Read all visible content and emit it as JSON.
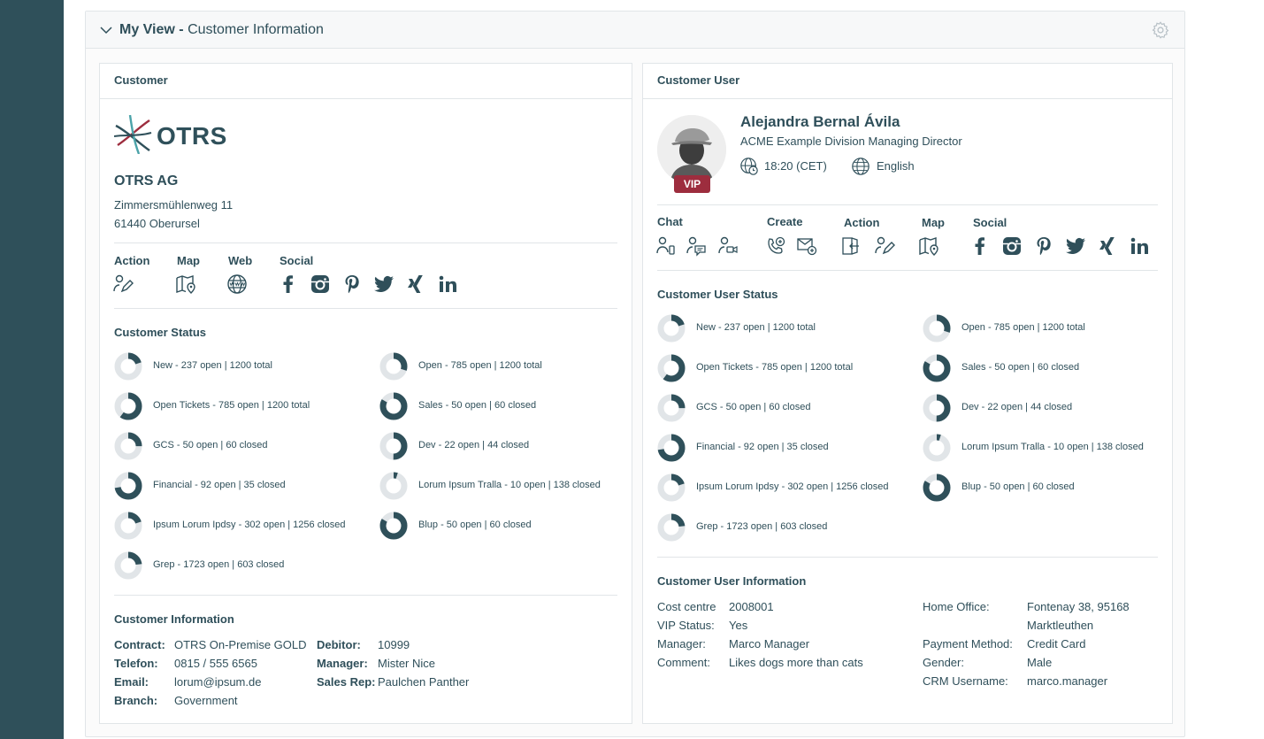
{
  "colors": {
    "sidebar": "#2f505a",
    "accent": "#2f505a",
    "vip": "#9d2d3e",
    "donut_track": "#e1e5e8"
  },
  "widget": {
    "title_bold": "My View -",
    "title_rest": " Customer Information"
  },
  "customer": {
    "panel_title": "Customer",
    "logo_text": "OTRS",
    "name": "OTRS AG",
    "address_line1": "Zimmersmühlenweg 11",
    "address_line2": "61440 Oberursel",
    "actions": {
      "action_label": "Action",
      "map_label": "Map",
      "web_label": "Web",
      "social_label": "Social"
    },
    "status_title": "Customer Status",
    "status_items": [
      {
        "label": "New - 237 open | 1200 total",
        "fraction": 0.2
      },
      {
        "label": "Open - 785 open | 1200 total",
        "fraction": 0.3
      },
      {
        "label": "Open Tickets - 785 open | 1200 total",
        "fraction": 0.6
      },
      {
        "label": "Sales - 50 open | 60 closed",
        "fraction": 0.83
      },
      {
        "label": "GCS - 50 open | 60 closed",
        "fraction": 0.25
      },
      {
        "label": "Dev - 22 open | 44 closed",
        "fraction": 0.5
      },
      {
        "label": "Financial - 92 open | 35 closed",
        "fraction": 0.72
      },
      {
        "label": "Lorum Ipsum Tralla - 10 open | 138 closed",
        "fraction": 0.05
      },
      {
        "label": "Ipsum Lorum Ipdsy - 302 open | 1256 closed",
        "fraction": 0.2
      },
      {
        "label": "Blup - 50 open | 60 closed",
        "fraction": 0.83
      },
      {
        "label": "Grep - 1723 open | 603 closed",
        "fraction": 0.23
      }
    ],
    "info_title": "Customer Information",
    "info": {
      "contract_label": "Contract:",
      "contract_value": "OTRS On-Premise GOLD",
      "telefon_label": "Telefon:",
      "telefon_value": "0815 / 555 6565",
      "email_label": "Email:",
      "email_value": "lorum@ipsum.de",
      "branch_label": "Branch:",
      "branch_value": "Government",
      "debitor_label": "Debitor:",
      "debitor_value": "10999",
      "manager_label": "Manager:",
      "manager_value": "Mister Nice",
      "salesrep_label": "Sales Rep:",
      "salesrep_value": "Paulchen Panther"
    }
  },
  "customer_user": {
    "panel_title": "Customer User",
    "vip_badge": "VIP",
    "name": "Alejandra Bernal Ávila",
    "title": "ACME Example Division Managing Director",
    "time": "18:20 (CET)",
    "language": "English",
    "actions": {
      "chat_label": "Chat",
      "create_label": "Create",
      "action_label": "Action",
      "map_label": "Map",
      "social_label": "Social"
    },
    "status_title": "Customer User Status",
    "status_items": [
      {
        "label": "New - 237 open | 1200 total",
        "fraction": 0.2
      },
      {
        "label": "Open - 785 open | 1200 total",
        "fraction": 0.3
      },
      {
        "label": "Open Tickets - 785 open | 1200 total",
        "fraction": 0.6
      },
      {
        "label": "Sales - 50 open | 60 closed",
        "fraction": 0.83
      },
      {
        "label": "GCS - 50 open | 60 closed",
        "fraction": 0.25
      },
      {
        "label": "Dev - 22 open | 44 closed",
        "fraction": 0.5
      },
      {
        "label": "Financial - 92 open | 35 closed",
        "fraction": 0.72
      },
      {
        "label": "Lorum Ipsum Tralla - 10 open | 138 closed",
        "fraction": 0.05
      },
      {
        "label": "Ipsum Lorum Ipdsy - 302 open | 1256 closed",
        "fraction": 0.2
      },
      {
        "label": "Blup - 50 open | 60 closed",
        "fraction": 0.83
      },
      {
        "label": "Grep - 1723 open | 603 closed",
        "fraction": 0.23
      }
    ],
    "info_title": "Customer User Information",
    "info": {
      "cost_label": "Cost centre",
      "cost_value": "2008001",
      "vip_label": "VIP Status:",
      "vip_value": "Yes",
      "manager_label": "Manager:",
      "manager_value": "Marco Manager",
      "comment_label": "Comment:",
      "comment_value": "Likes dogs more than cats",
      "home_label": "Home Office:",
      "home_value_1": "Fontenay 38, 95168",
      "home_value_2": "Marktleuthen",
      "payment_label": "Payment Method:",
      "payment_value": "Credit Card",
      "gender_label": "Gender:",
      "gender_value": "Male",
      "crm_label": "CRM Username:",
      "crm_value": "marco.manager"
    }
  }
}
